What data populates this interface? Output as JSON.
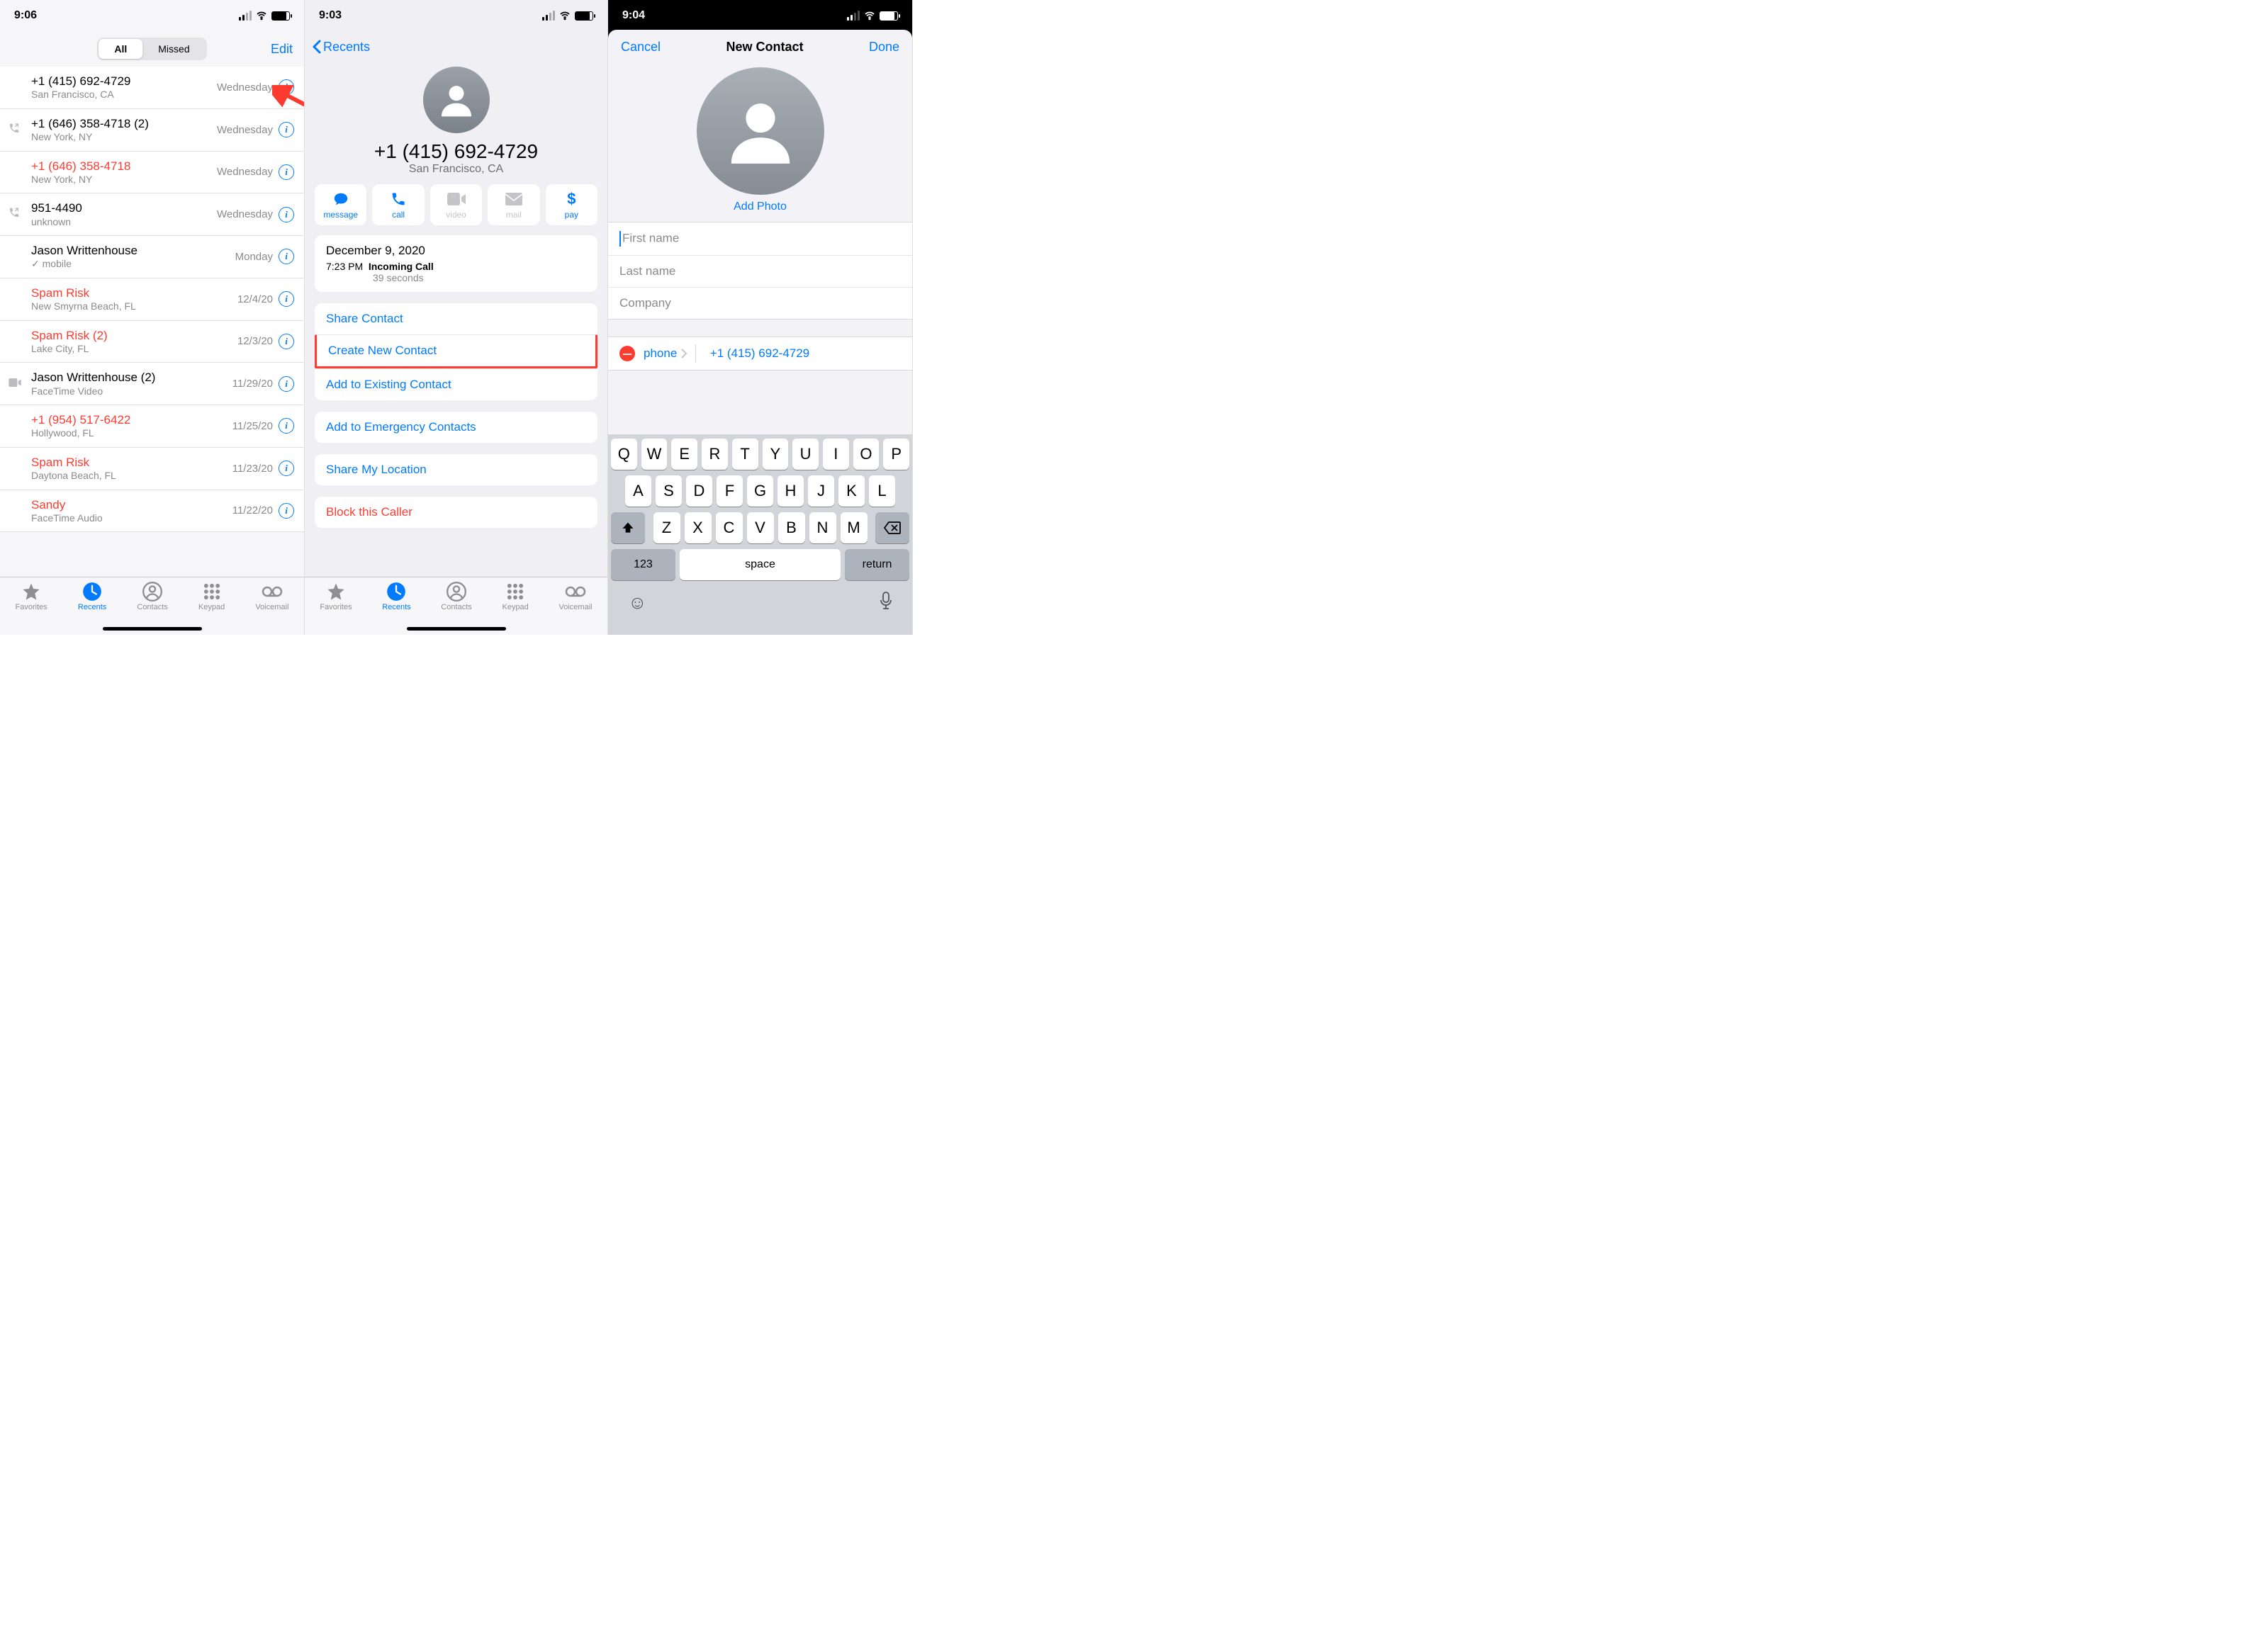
{
  "pane1": {
    "time": "9:06",
    "seg_all": "All",
    "seg_missed": "Missed",
    "edit": "Edit",
    "calls": [
      {
        "name": "+1 (415) 692-4729",
        "sub": "San Francisco, CA",
        "date": "Wednesday",
        "missed": false,
        "lead": ""
      },
      {
        "name": "+1 (646) 358-4718 (2)",
        "sub": "New York, NY",
        "date": "Wednesday",
        "missed": false,
        "lead": "out"
      },
      {
        "name": "+1 (646) 358-4718",
        "sub": "New York, NY",
        "date": "Wednesday",
        "missed": true,
        "lead": ""
      },
      {
        "name": "951-4490",
        "sub": "unknown",
        "date": "Wednesday",
        "missed": false,
        "lead": "out"
      },
      {
        "name": "Jason Writtenhouse",
        "sub": "✓ mobile",
        "date": "Monday",
        "missed": false,
        "lead": ""
      },
      {
        "name": "Spam Risk",
        "sub": "New Smyrna Beach, FL",
        "date": "12/4/20",
        "missed": true,
        "lead": ""
      },
      {
        "name": "Spam Risk (2)",
        "sub": "Lake City, FL",
        "date": "12/3/20",
        "missed": true,
        "lead": ""
      },
      {
        "name": "Jason Writtenhouse (2)",
        "sub": "FaceTime Video",
        "date": "11/29/20",
        "missed": false,
        "lead": "ft"
      },
      {
        "name": "+1 (954) 517-6422",
        "sub": "Hollywood, FL",
        "date": "11/25/20",
        "missed": true,
        "lead": ""
      },
      {
        "name": "Spam Risk",
        "sub": "Daytona Beach, FL",
        "date": "11/23/20",
        "missed": true,
        "lead": ""
      },
      {
        "name": "Sandy",
        "sub": "FaceTime Audio",
        "date": "11/22/20",
        "missed": true,
        "lead": ""
      }
    ],
    "tabs": {
      "fav": "Favorites",
      "rec": "Recents",
      "con": "Contacts",
      "key": "Keypad",
      "vm": "Voicemail"
    }
  },
  "pane2": {
    "time": "9:03",
    "back": "Recents",
    "number": "+1 (415) 692-4729",
    "location": "San Francisco, CA",
    "actions": {
      "msg": "message",
      "call": "call",
      "vid": "video",
      "mail": "mail",
      "pay": "pay"
    },
    "call_date": "December 9, 2020",
    "call_time": "7:23 PM",
    "call_type": "Incoming Call",
    "call_dur": "39 seconds",
    "share": "Share Contact",
    "create": "Create New Contact",
    "existing": "Add to Existing Contact",
    "emergency": "Add to Emergency Contacts",
    "location_share": "Share My Location",
    "block": "Block this Caller",
    "tabs": {
      "fav": "Favorites",
      "rec": "Recents",
      "con": "Contacts",
      "key": "Keypad",
      "vm": "Voicemail"
    }
  },
  "pane3": {
    "time": "9:04",
    "cancel": "Cancel",
    "title": "New Contact",
    "done": "Done",
    "addphoto": "Add Photo",
    "first": "First name",
    "last": "Last name",
    "company": "Company",
    "ptype": "phone",
    "pnum": "+1 (415) 692-4729",
    "kb": {
      "r1": [
        "Q",
        "W",
        "E",
        "R",
        "T",
        "Y",
        "U",
        "I",
        "O",
        "P"
      ],
      "r2": [
        "A",
        "S",
        "D",
        "F",
        "G",
        "H",
        "J",
        "K",
        "L"
      ],
      "r3": [
        "Z",
        "X",
        "C",
        "V",
        "B",
        "N",
        "M"
      ],
      "num": "123",
      "space": "space",
      "ret": "return"
    }
  }
}
